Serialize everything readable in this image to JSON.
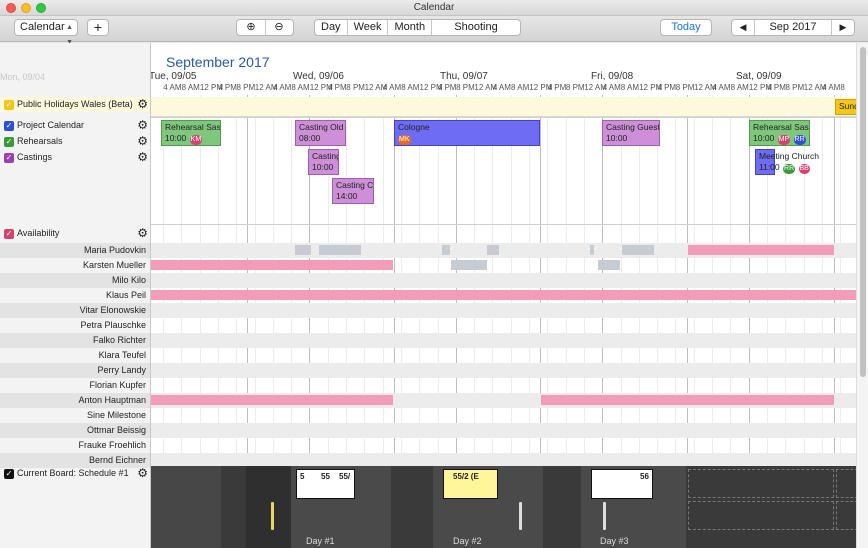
{
  "window": {
    "title": "Calendar"
  },
  "toolbar": {
    "calendar_label": "Calendar",
    "add_label": "+",
    "zoom_in": "⊕",
    "zoom_out": "⊖",
    "views": [
      "Day",
      "Week",
      "Month",
      "Shooting Period"
    ],
    "today_label": "Today",
    "prev": "◀",
    "period": "Sep 2017",
    "next": "▶"
  },
  "header": {
    "month": "September 2017",
    "ghost_day": "Mon, 09/04",
    "days": [
      "Tue, 09/05",
      "Wed, 09/06",
      "Thu, 09/07",
      "Fri, 09/08",
      "Sat, 09/09"
    ],
    "hours": [
      "M",
      "4 AM",
      "8 AM",
      "12 PM",
      "4 PM",
      "8 PM",
      "12 AM",
      "4 AM",
      "8 AM",
      "12 PM",
      "4 PM",
      "8 PM",
      "12 AM",
      "4 AM",
      "8 AM",
      "12 PM",
      "4 PM",
      "8 PM",
      "12 AM",
      "4 AM",
      "8 AM",
      "12 PM",
      "4 PM",
      "8 PM",
      "12 AM",
      "4 AM",
      "8 AM",
      "12 PM",
      "4 PM",
      "8 PM",
      "12 AM",
      "4 AM",
      "8 AM",
      "12 PM",
      "4 PM",
      "8 PM",
      "12 AM",
      "4 AM",
      "8"
    ]
  },
  "calendars": {
    "holidays": {
      "label": "Public Holidays Wales (Beta)",
      "color": "#f5c518",
      "event": "Sund"
    },
    "project": {
      "label": "Project Calendar",
      "color": "#2b4fd8"
    },
    "rehearsals": {
      "label": "Rehearsals",
      "color": "#3a9a3a"
    },
    "castings": {
      "label": "Castings",
      "color": "#9d3fb3"
    },
    "availability": {
      "label": "Availability",
      "color": "#d8426f"
    },
    "board": {
      "label": "Current Board: Schedule #1",
      "color": "#111111"
    }
  },
  "events": [
    {
      "title": "Rehearsal Saskia/Oli",
      "time": "10:00",
      "badges": [
        "KM"
      ]
    },
    {
      "title": "Casting Old Women",
      "time": "08:00",
      "badges": []
    },
    {
      "title": "Casting Rob",
      "time": "10:00",
      "badges": []
    },
    {
      "title": "Casting Children",
      "time": "14:00",
      "badges": []
    },
    {
      "title": "Cologne",
      "time": "",
      "badges": [
        "MK"
      ]
    },
    {
      "title": "Casting Guests",
      "time": "10:00",
      "badges": []
    },
    {
      "title": "Rehearsal Saskia/Oli",
      "time": "10:00",
      "badges": [
        "MP",
        "RR"
      ]
    },
    {
      "title": "Meeting Church",
      "time": "11:00",
      "badges": [
        "RR",
        "BB"
      ]
    }
  ],
  "people": [
    "Maria Pudovkin",
    "Karsten Mueller",
    "Milo Kilo",
    "Klaus Peil",
    "Vitar Elonowskie",
    "Petra Plauschke",
    "Falko Richter",
    "Klara Teufel",
    "Perry Landy",
    "Florian Kupfer",
    "Anton Hauptman",
    "Sine Milestone",
    "Ottmar Beissig",
    "Frauke Froehlich",
    "Bernd Eichner"
  ],
  "board": {
    "days": [
      "Day #1",
      "Day #2",
      "Day #3"
    ],
    "day1_cards": [
      "5",
      "55",
      "55/"
    ],
    "day2_cards": [
      "55/2 (E"
    ],
    "day3_cards": [
      "56"
    ]
  }
}
